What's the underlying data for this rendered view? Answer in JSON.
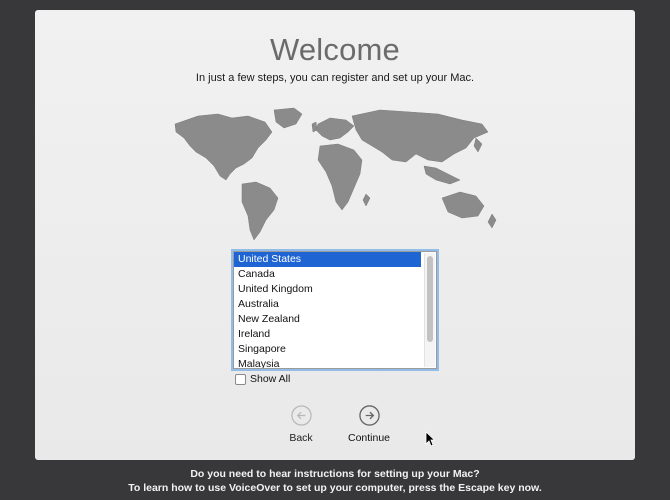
{
  "window": {
    "title": "Welcome",
    "subtitle": "In just a few steps, you can register and set up your Mac."
  },
  "country_list": {
    "items": [
      "United States",
      "Canada",
      "United Kingdom",
      "Australia",
      "New Zealand",
      "Ireland",
      "Singapore",
      "Malaysia"
    ],
    "selected": "United States"
  },
  "show_all": {
    "label": "Show All",
    "checked": false
  },
  "buttons": {
    "back": {
      "label": "Back",
      "enabled": false,
      "icon": "left-arrow-circle"
    },
    "continue": {
      "label": "Continue",
      "enabled": true,
      "icon": "right-arrow-circle"
    }
  },
  "voiceover": {
    "line1": "Do you need to hear instructions for setting up your Mac?",
    "line2": "To learn how to use VoiceOver to set up your computer, press the Escape key now."
  },
  "colors": {
    "selection": "#1f64d3",
    "focus_ring": "#93bde9",
    "background": "#38383a"
  }
}
